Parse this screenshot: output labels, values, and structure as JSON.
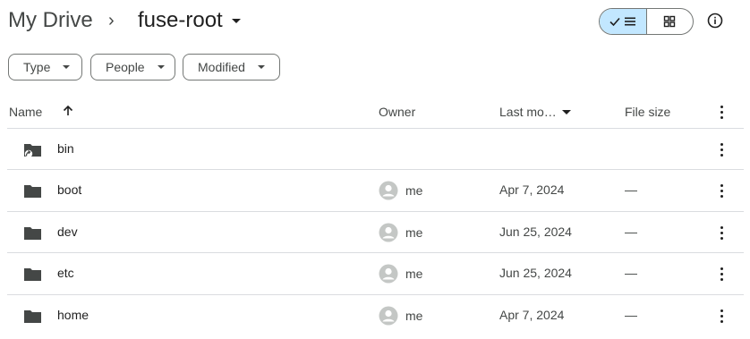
{
  "breadcrumb": {
    "root": "My Drive",
    "separator": "›",
    "current": "fuse-root"
  },
  "view_toggle": {
    "active": "list"
  },
  "filters": [
    {
      "label": "Type"
    },
    {
      "label": "People"
    },
    {
      "label": "Modified"
    }
  ],
  "table": {
    "columns": {
      "name": "Name",
      "owner": "Owner",
      "modified": "Last mo…",
      "size": "File size"
    },
    "rows": [
      {
        "name": "bin",
        "shared": true,
        "owner": "",
        "modified": "",
        "size": ""
      },
      {
        "name": "boot",
        "shared": false,
        "owner": "me",
        "modified": "Apr 7, 2024",
        "size": "—"
      },
      {
        "name": "dev",
        "shared": false,
        "owner": "me",
        "modified": "Jun 25, 2024",
        "size": "—"
      },
      {
        "name": "etc",
        "shared": false,
        "owner": "me",
        "modified": "Jun 25, 2024",
        "size": "—"
      },
      {
        "name": "home",
        "shared": false,
        "owner": "me",
        "modified": "Apr 7, 2024",
        "size": "—"
      }
    ]
  },
  "colors": {
    "accent_bg": "#c2e7ff",
    "text": "#1f1f1f",
    "muted": "#444746",
    "divider": "#dadce0"
  }
}
